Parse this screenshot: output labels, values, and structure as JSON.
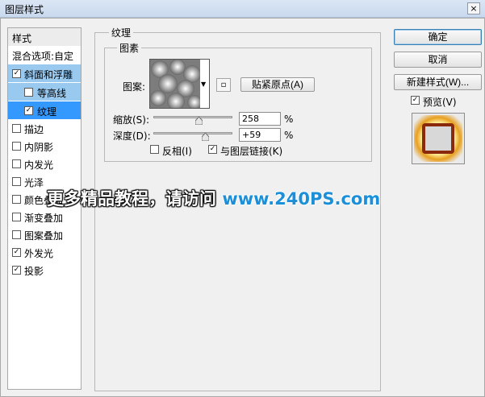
{
  "window": {
    "title": "图层样式",
    "close_icon": "×"
  },
  "left": {
    "header": "样式",
    "blend_options": "混合选项:自定",
    "items": [
      {
        "label": "斜面和浮雕",
        "checked": true
      },
      {
        "label": "等高线",
        "checked": false
      },
      {
        "label": "纹理",
        "checked": true
      },
      {
        "label": "描边",
        "checked": false
      },
      {
        "label": "内阴影",
        "checked": false
      },
      {
        "label": "内发光",
        "checked": false
      },
      {
        "label": "光泽",
        "checked": false
      },
      {
        "label": "颜色叠加",
        "checked": false
      },
      {
        "label": "渐变叠加",
        "checked": false
      },
      {
        "label": "图案叠加",
        "checked": false
      },
      {
        "label": "外发光",
        "checked": true
      },
      {
        "label": "投影",
        "checked": true
      }
    ]
  },
  "main": {
    "group_title": "纹理",
    "sub_group_title": "图素",
    "pattern_label": "图案:",
    "snap_button": "贴紧原点(A)",
    "scale_label": "缩放(S):",
    "scale_value": "258",
    "scale_fraction": 0.58,
    "depth_label": "深度(D):",
    "depth_value": "+59",
    "depth_fraction": 0.66,
    "percent": "%",
    "invert_label": "反相(I)",
    "invert_checked": false,
    "link_label": "与图层链接(K)",
    "link_checked": true
  },
  "right": {
    "ok": "确定",
    "cancel": "取消",
    "new_style": "新建样式(W)...",
    "preview_label": "预览(V)",
    "preview_checked": true
  },
  "watermark": {
    "text": "更多精品教程，请访问",
    "url": "www.240PS.com"
  },
  "colors": {
    "selected_row": "#99c9ef",
    "active_row": "#3399ff",
    "watermark_url": "#1c8fd9",
    "preview_glow": "#c24a12"
  }
}
